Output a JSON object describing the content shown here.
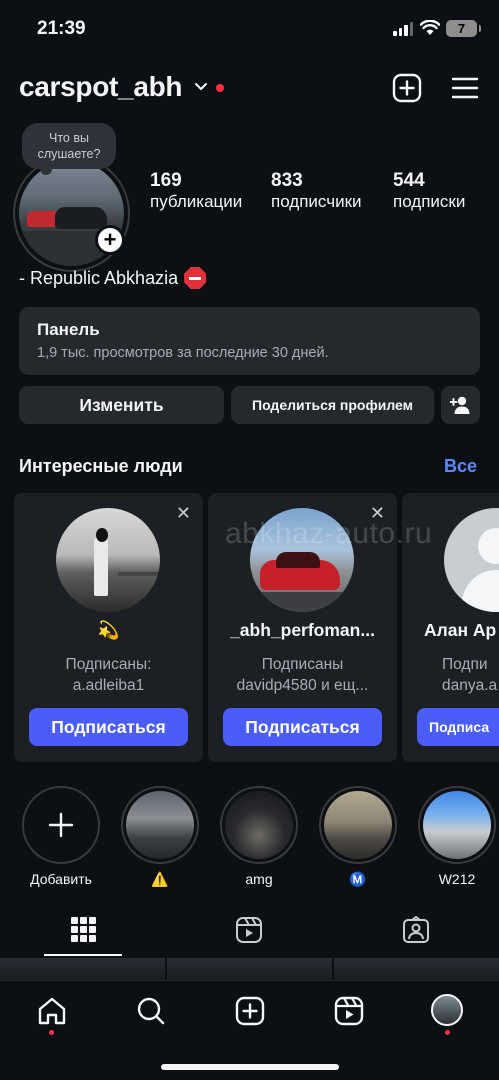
{
  "status": {
    "time": "21:39",
    "battery": "7"
  },
  "header": {
    "username": "carspot_abh"
  },
  "profile": {
    "note_bubble": "Что вы слушаете?",
    "stats": [
      {
        "value": "169",
        "label": "публикации"
      },
      {
        "value": "833",
        "label": "подписчики"
      },
      {
        "value": "544",
        "label": "подписки"
      }
    ],
    "bio": "- Republic Abkhazia"
  },
  "panel": {
    "title": "Панель",
    "subtitle": "1,9 тыс. просмотров за последние 30 дней."
  },
  "actions": {
    "edit": "Изменить",
    "share": "Поделиться профилем"
  },
  "suggestions": {
    "title": "Интересные люди",
    "see_all": "Все",
    "watermark": "abkhaz-auto.ru",
    "follow_label": "Подписаться",
    "cards": [
      {
        "name": "💫",
        "meta1": "Подписаны:",
        "meta2": "a.adleiba1"
      },
      {
        "name": "_abh_perfoman...",
        "meta1": "Подписаны",
        "meta2": "davidp4580 и ещ..."
      },
      {
        "name": "Алан Ар",
        "meta1": "Подпи",
        "meta2": "danya.a",
        "follow": "Подписа"
      }
    ]
  },
  "highlights": [
    {
      "label": "Добавить"
    },
    {
      "label": "⚠️"
    },
    {
      "label": "amg"
    },
    {
      "label": "Ⓜ️"
    },
    {
      "label": "W212"
    }
  ]
}
